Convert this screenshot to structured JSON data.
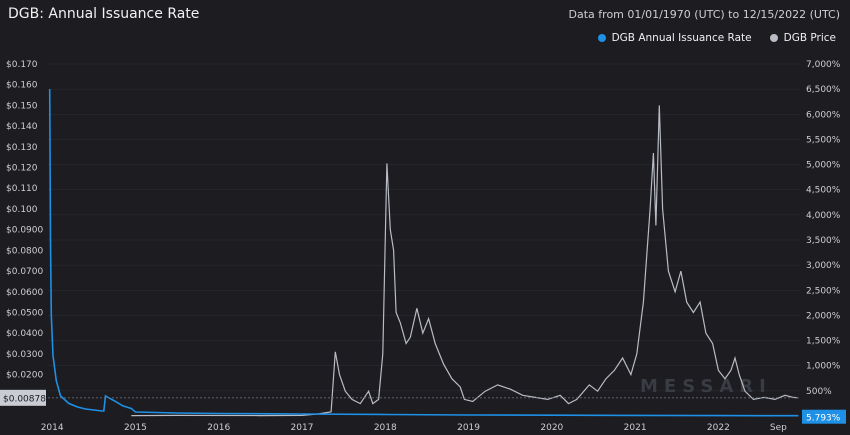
{
  "header": {
    "title": "DGB: Annual Issuance Rate",
    "date_range": "Data from 01/01/1970 (UTC) to 12/15/2022 (UTC)"
  },
  "legend": [
    {
      "label": "DGB Annual Issuance Rate",
      "color": "#1e90e6"
    },
    {
      "label": "DGB Price",
      "color": "#b9bcc4"
    }
  ],
  "watermark": "MESSARI",
  "chart_data": {
    "type": "line",
    "x_ticks": [
      "2014",
      "2015",
      "2016",
      "2017",
      "2018",
      "2019",
      "2020",
      "2021",
      "2022",
      "Sep"
    ],
    "y_left_ticks": [
      "$0.170",
      "$0.160",
      "$0.150",
      "$0.140",
      "$0.130",
      "$0.120",
      "$0.110",
      "$0.100",
      "$0.0900",
      "$0.0800",
      "$0.0700",
      "$0.0600",
      "$0.0500",
      "$0.0400",
      "$0.0300",
      "$0.0200"
    ],
    "y_right_ticks": [
      "7,000%",
      "6,500%",
      "6,000%",
      "5,500%",
      "5,000%",
      "4,500%",
      "4,000%",
      "3,500%",
      "3,000%",
      "2,500%",
      "2,000%",
      "1,500%",
      "1,000%",
      "500%"
    ],
    "y_left_range": [
      0.0,
      0.17
    ],
    "y_right_range": [
      0,
      7000
    ],
    "current_price_label": "$0.00878",
    "current_issuance_label": "5.793%",
    "series": [
      {
        "name": "DGB Price",
        "axis": "left",
        "color": "#b9bcc4",
        "points": [
          [
            2014.95,
            0.0002
          ],
          [
            2015.5,
            0.0003
          ],
          [
            2016.5,
            0.0002
          ],
          [
            2017.0,
            0.0003
          ],
          [
            2017.2,
            0.001
          ],
          [
            2017.35,
            0.002
          ],
          [
            2017.4,
            0.031
          ],
          [
            2017.45,
            0.02
          ],
          [
            2017.52,
            0.012
          ],
          [
            2017.6,
            0.008
          ],
          [
            2017.7,
            0.006
          ],
          [
            2017.8,
            0.012
          ],
          [
            2017.85,
            0.006
          ],
          [
            2017.92,
            0.008
          ],
          [
            2017.97,
            0.03
          ],
          [
            2018.02,
            0.122
          ],
          [
            2018.06,
            0.09
          ],
          [
            2018.1,
            0.08
          ],
          [
            2018.13,
            0.05
          ],
          [
            2018.18,
            0.045
          ],
          [
            2018.25,
            0.035
          ],
          [
            2018.3,
            0.038
          ],
          [
            2018.38,
            0.052
          ],
          [
            2018.45,
            0.04
          ],
          [
            2018.52,
            0.047
          ],
          [
            2018.6,
            0.035
          ],
          [
            2018.7,
            0.025
          ],
          [
            2018.8,
            0.018
          ],
          [
            2018.9,
            0.014
          ],
          [
            2018.95,
            0.008
          ],
          [
            2019.05,
            0.007
          ],
          [
            2019.2,
            0.012
          ],
          [
            2019.35,
            0.015
          ],
          [
            2019.5,
            0.013
          ],
          [
            2019.65,
            0.01
          ],
          [
            2019.8,
            0.009
          ],
          [
            2019.95,
            0.008
          ],
          [
            2020.1,
            0.01
          ],
          [
            2020.2,
            0.006
          ],
          [
            2020.3,
            0.008
          ],
          [
            2020.45,
            0.015
          ],
          [
            2020.55,
            0.012
          ],
          [
            2020.65,
            0.018
          ],
          [
            2020.75,
            0.022
          ],
          [
            2020.85,
            0.028
          ],
          [
            2020.95,
            0.02
          ],
          [
            2021.02,
            0.03
          ],
          [
            2021.1,
            0.055
          ],
          [
            2021.18,
            0.1
          ],
          [
            2021.22,
            0.127
          ],
          [
            2021.25,
            0.092
          ],
          [
            2021.29,
            0.15
          ],
          [
            2021.33,
            0.1
          ],
          [
            2021.4,
            0.07
          ],
          [
            2021.48,
            0.06
          ],
          [
            2021.55,
            0.07
          ],
          [
            2021.62,
            0.055
          ],
          [
            2021.7,
            0.05
          ],
          [
            2021.78,
            0.055
          ],
          [
            2021.85,
            0.04
          ],
          [
            2021.93,
            0.035
          ],
          [
            2022.0,
            0.022
          ],
          [
            2022.08,
            0.018
          ],
          [
            2022.15,
            0.022
          ],
          [
            2022.2,
            0.028
          ],
          [
            2022.25,
            0.02
          ],
          [
            2022.32,
            0.012
          ],
          [
            2022.42,
            0.008
          ],
          [
            2022.55,
            0.009
          ],
          [
            2022.68,
            0.008
          ],
          [
            2022.8,
            0.01
          ],
          [
            2022.9,
            0.009
          ],
          [
            2022.96,
            0.00878
          ]
        ]
      },
      {
        "name": "DGB Annual Issuance Rate",
        "axis": "right",
        "color": "#1e90e6",
        "points": [
          [
            2013.97,
            6500
          ],
          [
            2013.98,
            3500
          ],
          [
            2013.99,
            2000
          ],
          [
            2014.01,
            1200
          ],
          [
            2014.05,
            700
          ],
          [
            2014.1,
            400
          ],
          [
            2014.2,
            250
          ],
          [
            2014.3,
            180
          ],
          [
            2014.4,
            140
          ],
          [
            2014.5,
            120
          ],
          [
            2014.6,
            100
          ],
          [
            2014.62,
            100
          ],
          [
            2014.64,
            400
          ],
          [
            2014.66,
            380
          ],
          [
            2014.75,
            300
          ],
          [
            2014.85,
            200
          ],
          [
            2014.95,
            150
          ],
          [
            2015.0,
            80
          ],
          [
            2015.5,
            60
          ],
          [
            2016.0,
            50
          ],
          [
            2017.0,
            40
          ],
          [
            2018.0,
            30
          ],
          [
            2019.0,
            20
          ],
          [
            2020.0,
            15
          ],
          [
            2021.0,
            12
          ],
          [
            2022.0,
            8
          ],
          [
            2022.96,
            5.793
          ]
        ]
      }
    ]
  }
}
